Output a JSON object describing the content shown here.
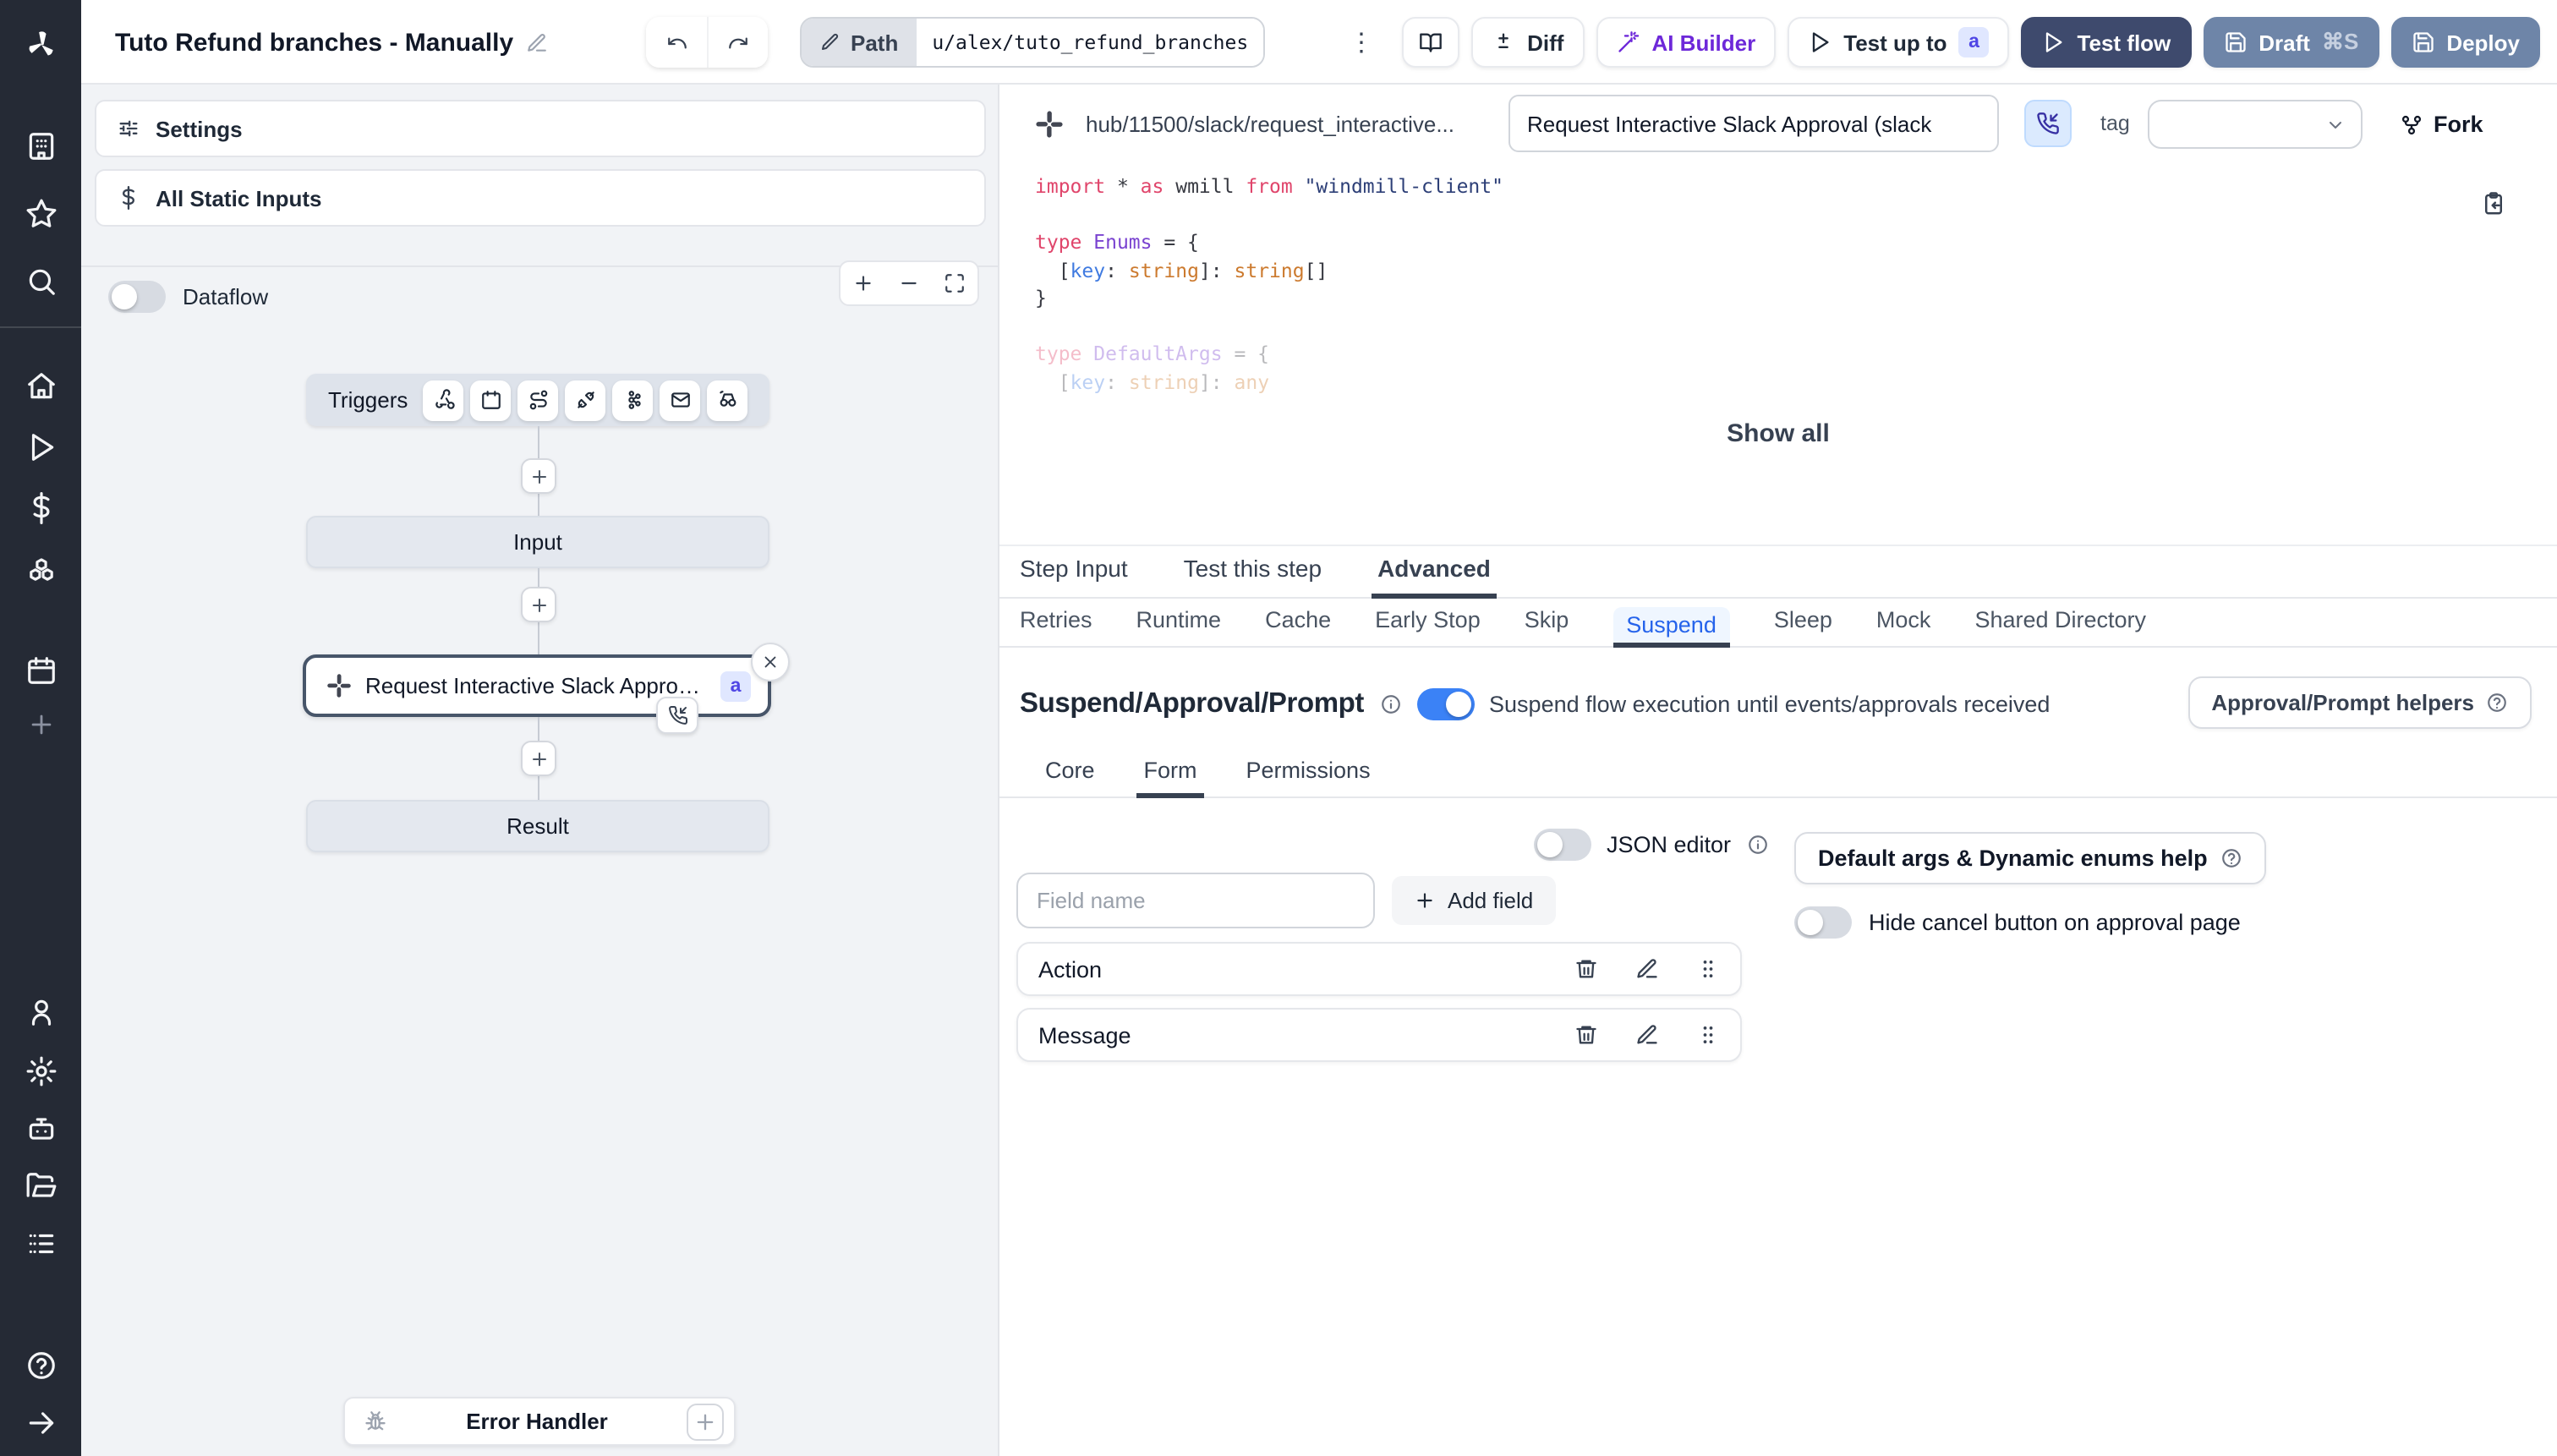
{
  "topbar": {
    "title": "Tuto Refund branches - Manually",
    "path_label": "Path",
    "path_value": "u/alex/tuto_refund_branches_",
    "diff": "Diff",
    "ai_builder": "AI Builder",
    "test_up_to": "Test up to",
    "test_badge": "a",
    "test_flow": "Test flow",
    "draft": "Draft",
    "draft_shortcut": "⌘S",
    "deploy": "Deploy"
  },
  "flow": {
    "settings": "Settings",
    "all_static_inputs": "All Static Inputs",
    "dataflow": "Dataflow",
    "triggers": "Triggers",
    "input_node": "Input",
    "step_label": "Request Interactive Slack Approval (...",
    "step_badge": "a",
    "result_node": "Result",
    "error_handler": "Error Handler"
  },
  "step": {
    "hub_path": "hub/11500/slack/request_interactive...",
    "name_value": "Request Interactive Slack Approval (slack",
    "tag_label": "tag",
    "fork": "Fork",
    "show_all": "Show all"
  },
  "code": {
    "lines": [
      {
        "tokens": [
          [
            "kw",
            "import"
          ],
          [
            "pl",
            " * "
          ],
          [
            "kw",
            "as"
          ],
          [
            "pl",
            " wmill "
          ],
          [
            "kw",
            "from"
          ],
          [
            "str",
            " \"windmill-client\""
          ]
        ]
      },
      {
        "tokens": []
      },
      {
        "tokens": [
          [
            "kw",
            "type"
          ],
          [
            "ty",
            " Enums"
          ],
          [
            "pl",
            " = {"
          ]
        ]
      },
      {
        "tokens": [
          [
            "pl",
            "  ["
          ],
          [
            "vr",
            "key"
          ],
          [
            "pl",
            ": "
          ],
          [
            "or",
            "string"
          ],
          [
            "pl",
            "]: "
          ],
          [
            "or",
            "string"
          ],
          [
            "pl",
            "[]"
          ]
        ]
      },
      {
        "tokens": [
          [
            "pl",
            "}"
          ]
        ]
      },
      {
        "tokens": []
      },
      {
        "tokens": [
          [
            "kw",
            "type"
          ],
          [
            "ty",
            " DefaultArgs"
          ],
          [
            "pl",
            " = {"
          ]
        ],
        "faded": true
      },
      {
        "tokens": [
          [
            "pl",
            "  ["
          ],
          [
            "vr",
            "key"
          ],
          [
            "pl",
            ": "
          ],
          [
            "or",
            "string"
          ],
          [
            "pl",
            "]: "
          ],
          [
            "or",
            "any"
          ]
        ],
        "faded": true
      }
    ]
  },
  "tabs": {
    "main": {
      "items": [
        "Step Input",
        "Test this step",
        "Advanced"
      ],
      "active": "Advanced"
    },
    "advanced": {
      "items": [
        "Retries",
        "Runtime",
        "Cache",
        "Early Stop",
        "Skip",
        "Suspend",
        "Sleep",
        "Mock",
        "Shared Directory"
      ],
      "active": "Suspend"
    },
    "form": {
      "items": [
        "Core",
        "Form",
        "Permissions"
      ],
      "active": "Form"
    }
  },
  "suspend": {
    "heading": "Suspend/Approval/Prompt",
    "toggle_on": true,
    "description": "Suspend flow execution until events/approvals received",
    "helpers": "Approval/Prompt helpers",
    "json_editor": "JSON editor",
    "field_placeholder": "Field name",
    "add_field": "Add field",
    "default_args_help": "Default args & Dynamic enums help",
    "hide_cancel": "Hide cancel button on approval page",
    "fields": [
      "Action",
      "Message"
    ]
  },
  "colors": {
    "toggle_on": "#3b82f6",
    "test_flow_bg": "#3e4a6d",
    "deploy_bg": "#6e85a8",
    "badge_bg": "#e0e7ff",
    "badge_text": "#4f46e5",
    "active_subtab_text": "#2563eb",
    "sidebar_bg": "#252a35",
    "canvas_bg": "#f1f3f6"
  }
}
